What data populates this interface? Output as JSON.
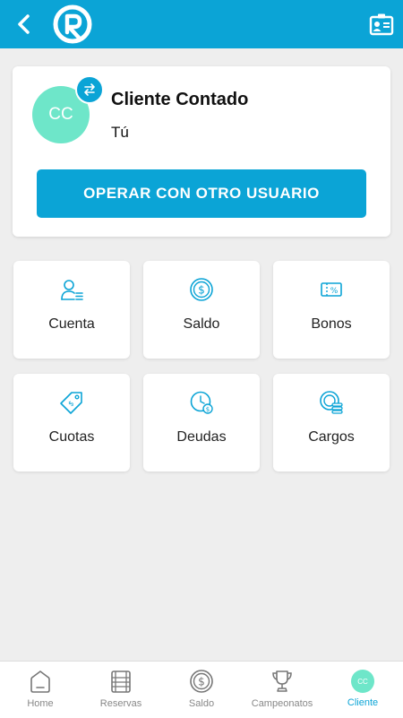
{
  "colors": {
    "brand": "#0ba4d6",
    "avatar": "#6ee6c9",
    "background": "#eeeeee"
  },
  "header": {
    "back_icon": "chevron-left-icon",
    "logo_icon": "app-logo-icon",
    "card_icon": "id-card-icon"
  },
  "user": {
    "initials": "CC",
    "name": "Cliente Contado",
    "role": "Tú",
    "switch_icon": "swap-arrows-icon",
    "operate_label": "OPERAR CON OTRO USUARIO"
  },
  "tiles": [
    {
      "label": "Cuenta",
      "icon": "user-list-icon"
    },
    {
      "label": "Saldo",
      "icon": "dollar-coin-icon"
    },
    {
      "label": "Bonos",
      "icon": "percent-ticket-icon"
    },
    {
      "label": "Cuotas",
      "icon": "price-tag-icon"
    },
    {
      "label": "Deudas",
      "icon": "clock-coin-icon"
    },
    {
      "label": "Cargos",
      "icon": "coin-stack-icon"
    }
  ],
  "bottom_nav": [
    {
      "label": "Home",
      "icon": "home-icon"
    },
    {
      "label": "Reservas",
      "icon": "calendar-grid-icon"
    },
    {
      "label": "Saldo",
      "icon": "dollar-coin-icon"
    },
    {
      "label": "Campeonatos",
      "icon": "trophy-icon"
    },
    {
      "label": "Cliente",
      "icon": "avatar",
      "initials": "CC",
      "active": true
    }
  ]
}
